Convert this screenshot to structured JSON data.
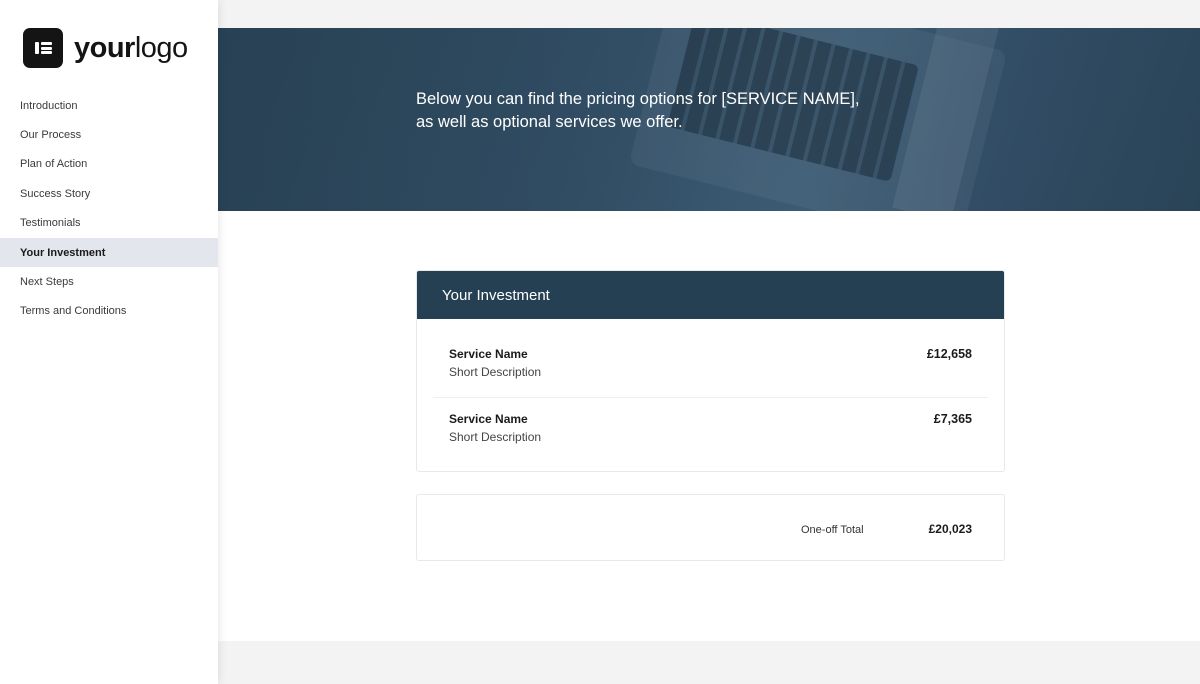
{
  "sidebar": {
    "logo": {
      "strong": "your",
      "light": "logo"
    },
    "items": [
      {
        "label": "Introduction",
        "active": false
      },
      {
        "label": "Our Process",
        "active": false
      },
      {
        "label": "Plan of Action",
        "active": false
      },
      {
        "label": "Success Story",
        "active": false
      },
      {
        "label": "Testimonials",
        "active": false
      },
      {
        "label": "Your Investment",
        "active": true
      },
      {
        "label": "Next Steps",
        "active": false
      },
      {
        "label": "Terms and Conditions",
        "active": false
      }
    ]
  },
  "hero": {
    "line1": "Below you can find the pricing options for [SERVICE NAME],",
    "line2": "as well as optional services we offer."
  },
  "investment": {
    "title": "Your Investment",
    "items": [
      {
        "name": "Service Name",
        "description": "Short Description",
        "price": "£12,658"
      },
      {
        "name": "Service Name",
        "description": "Short Description",
        "price": "£7,365"
      }
    ],
    "total_label": "One-off Total",
    "total_value": "£20,023"
  },
  "colors": {
    "header_bg": "#253f53",
    "active_nav_bg": "#e3e6ed",
    "page_bg": "#f3f3f3"
  }
}
